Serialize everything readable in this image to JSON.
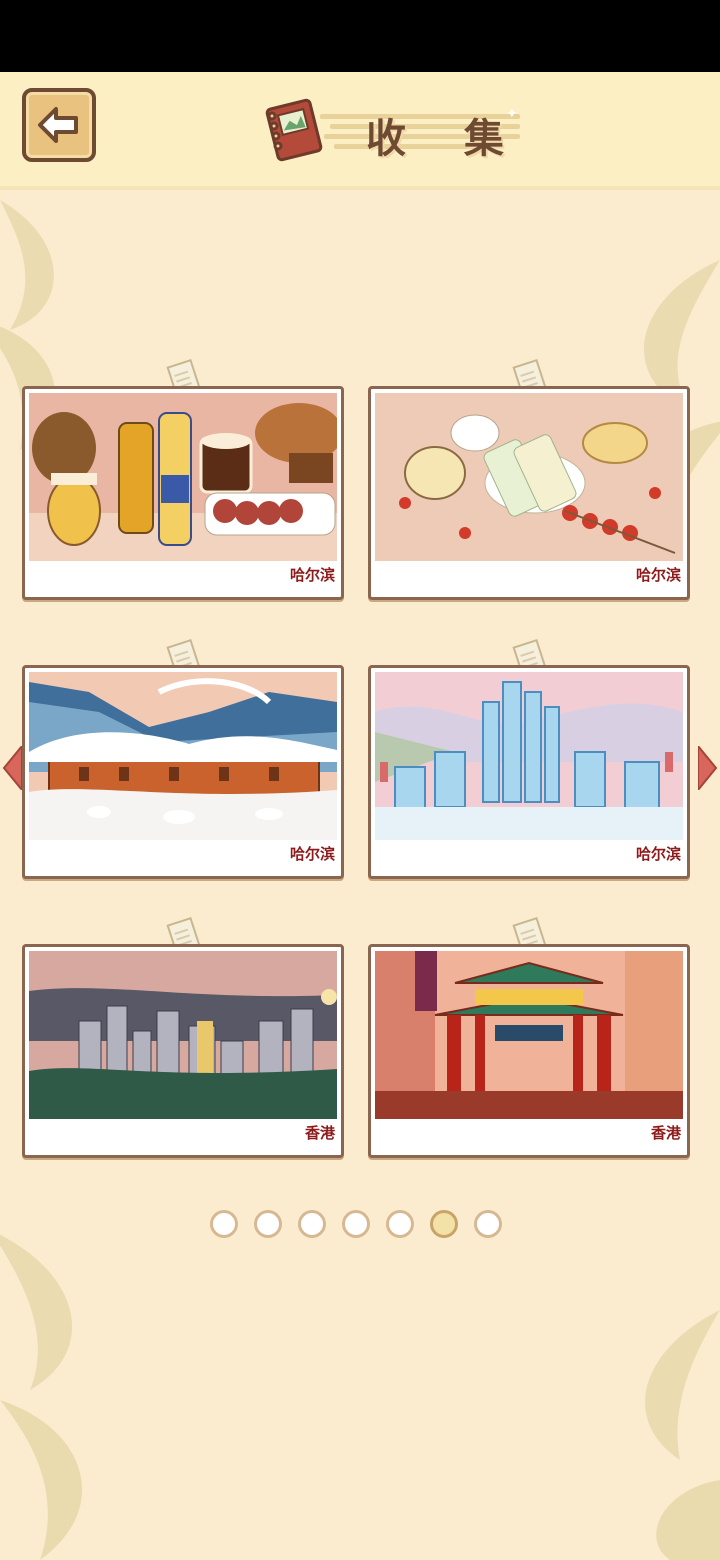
{
  "header": {
    "title": "收 集",
    "back_icon": "back-arrow-icon",
    "book_icon": "book-icon"
  },
  "cards": [
    {
      "label": "哈尔滨",
      "scene": "harbin-food-beer-sausage"
    },
    {
      "label": "哈尔滨",
      "scene": "harbin-ice-cream-tanghulu"
    },
    {
      "label": "哈尔滨",
      "scene": "harbin-snow-village"
    },
    {
      "label": "哈尔滨",
      "scene": "harbin-ice-castle"
    },
    {
      "label": "香港",
      "scene": "hongkong-skyline"
    },
    {
      "label": "香港",
      "scene": "hongkong-temple-gate"
    }
  ],
  "pagination": {
    "total": 7,
    "active_index": 5
  },
  "colors": {
    "background": "#fbecd0",
    "header": "#fcefc4",
    "accent_brown": "#6e4a33",
    "label_red": "#8e1b1b",
    "arrow_red": "#d9665a"
  }
}
